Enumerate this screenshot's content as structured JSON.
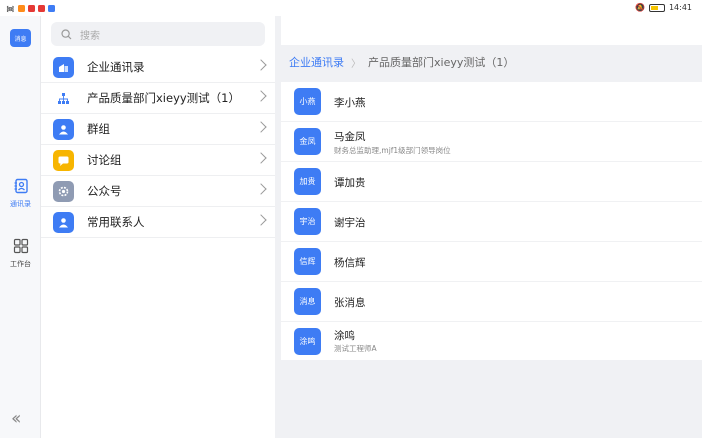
{
  "status_bar": {
    "time": "14:41",
    "battery_percent": 60
  },
  "rail": {
    "messages_badge": "消息",
    "items": [
      {
        "label": "通讯录",
        "active": true
      },
      {
        "label": "工作台",
        "active": false
      }
    ]
  },
  "search": {
    "placeholder": "搜索"
  },
  "nav": {
    "items": [
      {
        "label": "企业通讯录",
        "icon": "building-icon",
        "color": "#3e7cf4"
      },
      {
        "label": "产品质量部门xieyy测试（1）",
        "icon": "org-tree-icon",
        "color": "#3e7cf4"
      },
      {
        "label": "群组",
        "icon": "group-icon",
        "color": "#3e7cf4"
      },
      {
        "label": "讨论组",
        "icon": "chat-icon",
        "color": "#f7b500"
      },
      {
        "label": "公众号",
        "icon": "gear-icon",
        "color": "#8f9bb3"
      },
      {
        "label": "常用联系人",
        "icon": "contact-icon",
        "color": "#3e7cf4"
      }
    ]
  },
  "breadcrumb": {
    "root": "企业通讯录",
    "current": "产品质量部门xieyy测试（1）"
  },
  "contacts": [
    {
      "avatar": "小燕",
      "name": "李小燕",
      "subtitle": ""
    },
    {
      "avatar": "金凤",
      "name": "马金凤",
      "subtitle": "财务总监助理,mjf1级部门领导岗位"
    },
    {
      "avatar": "加贵",
      "name": "谭加贵",
      "subtitle": ""
    },
    {
      "avatar": "宇治",
      "name": "谢宇治",
      "subtitle": ""
    },
    {
      "avatar": "信辉",
      "name": "杨信辉",
      "subtitle": ""
    },
    {
      "avatar": "消息",
      "name": "张消息",
      "subtitle": ""
    },
    {
      "avatar": "涂鸣",
      "name": "涂鸣",
      "subtitle": "测试工程师A"
    }
  ]
}
